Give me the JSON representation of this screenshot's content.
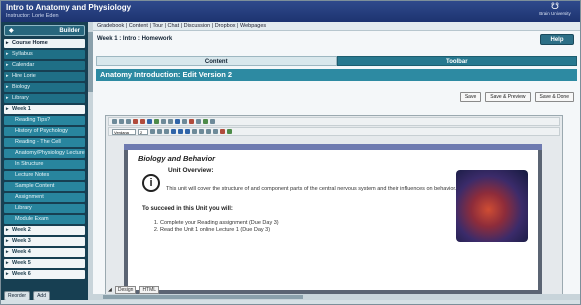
{
  "header": {
    "title": "Intro to Anatomy and Physiology",
    "subtitle": "Instructor: Lorie Eden",
    "logo_mark": "☋",
    "logo_text": "Brain\nUniversity"
  },
  "sidebar": {
    "builder_label": "Builder",
    "course_home": "Course Home",
    "items": [
      {
        "label": "Syllabus",
        "type": "item"
      },
      {
        "label": "Calendar",
        "type": "item"
      },
      {
        "label": "Hire Lorie",
        "type": "item"
      },
      {
        "label": "Biology",
        "type": "item"
      },
      {
        "label": "Library",
        "type": "item"
      },
      {
        "label": "Week 1",
        "type": "week"
      },
      {
        "label": "Reading Tips?",
        "type": "sub"
      },
      {
        "label": "History of Psychology",
        "type": "sub"
      },
      {
        "label": "Reading - The Cell",
        "type": "sub"
      },
      {
        "label": "Anatomy/Physiology Lecture",
        "type": "sub"
      },
      {
        "label": "In Structure",
        "type": "sub"
      },
      {
        "label": "Lecture Notes",
        "type": "sub"
      },
      {
        "label": "Sample Content",
        "type": "sub"
      },
      {
        "label": "Assignment",
        "type": "sub"
      },
      {
        "label": "Library",
        "type": "sub"
      },
      {
        "label": "Module Exam",
        "type": "sub"
      },
      {
        "label": "Week 2",
        "type": "week"
      },
      {
        "label": "Week 3",
        "type": "week"
      },
      {
        "label": "Week 4",
        "type": "week"
      },
      {
        "label": "Week 5",
        "type": "week"
      },
      {
        "label": "Week 6",
        "type": "week"
      }
    ],
    "footer_buttons": [
      "Reorder",
      "Add"
    ]
  },
  "main": {
    "breadcrumb": "Gradebook | Content | Tour | Chat | Discussion | Dropbox | Webpages",
    "week_title": "Week 1 : Intro : Homework",
    "help_label": "Help",
    "tabs": [
      {
        "label": "Content",
        "active": true
      },
      {
        "label": "Toolbar",
        "active": false
      }
    ],
    "edit_title": "Anatomy Introduction: Edit Version 2",
    "actions": [
      "Save",
      "Save & Preview",
      "Save & Done"
    ],
    "toolbar_font": "Verdana",
    "toolbar_size": "2"
  },
  "document": {
    "heading": "Biology and Behavior",
    "overview": "Unit Overview:",
    "info_icon": "i",
    "paragraph": "This unit will cover the structure of and component parts of the central nervous system and their influences on behavior.",
    "succeed": "To succeed in this Unit you will:",
    "list": [
      "Complete your Reading assignment (Due Day 3)",
      "Read the Unit 1 online Lecture 1 (Due Day 3)"
    ]
  },
  "editor_footer": {
    "mode": "Design",
    "html": "HTML"
  }
}
